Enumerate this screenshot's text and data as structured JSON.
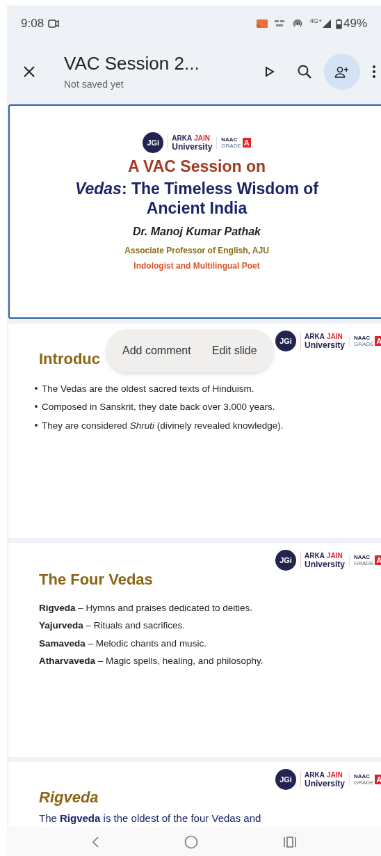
{
  "status_bar": {
    "time": "9:08",
    "battery": "49%",
    "network": "4G+"
  },
  "app_bar": {
    "title": "VAC Session 2...",
    "subtitle": "Not saved yet"
  },
  "slides": [
    {
      "kind": "title",
      "selected": true,
      "logo": {
        "badge": "JGi",
        "name_1": "ARKA",
        "name_2": "JAIN",
        "name_3": "University",
        "accreditation": "NAAC",
        "grade_label": "GRADE",
        "grade": "A"
      },
      "heading": "A VAC Session on",
      "title": "*Vedas*: The Timeless Wisdom of Ancient India",
      "author": "Dr. Manoj Kumar Pathak",
      "role": "Associate Professor of English, AJU",
      "tagline": "Indologist and Multilingual Poet"
    },
    {
      "kind": "bullets",
      "selected": false,
      "logo": {
        "badge": "JGi",
        "name_1": "ARKA",
        "name_2": "JAIN",
        "name_3": "University",
        "accreditation": "NAAC",
        "grade_label": "GRADE",
        "grade": "A"
      },
      "heading": "Introduc",
      "items": [
        "The Vedas are the oldest sacred texts of Hinduism.",
        "Composed in Sanskrit, they date back over 3,000 years.",
        "They are considered *Shruti* (divinely revealed knowledge)."
      ],
      "popup": [
        "Add comment",
        "Edit slide"
      ]
    },
    {
      "kind": "lines",
      "selected": false,
      "logo": {
        "badge": "JGi",
        "name_1": "ARKA",
        "name_2": "JAIN",
        "name_3": "University",
        "accreditation": "NAAC",
        "grade_label": "GRADE",
        "grade": "A"
      },
      "heading": "The Four Vedas",
      "items": [
        "**Rigveda** – Hymns and praises dedicated to deities.",
        "**Yajurveda** – Rituals and sacrifices.",
        "**Samaveda** – Melodic chants and music.",
        "**Atharvaveda** – Magic spells, healing, and philosophy."
      ]
    },
    {
      "kind": "paragraph",
      "selected": false,
      "logo": {
        "badge": "JGi",
        "name_1": "ARKA",
        "name_2": "JAIN",
        "name_3": "University",
        "accreditation": "NAAC",
        "grade_label": "GRADE",
        "grade": "A"
      },
      "heading": "Rigveda",
      "text": "The **Rigveda** is the oldest of the four Vedas and"
    }
  ]
}
